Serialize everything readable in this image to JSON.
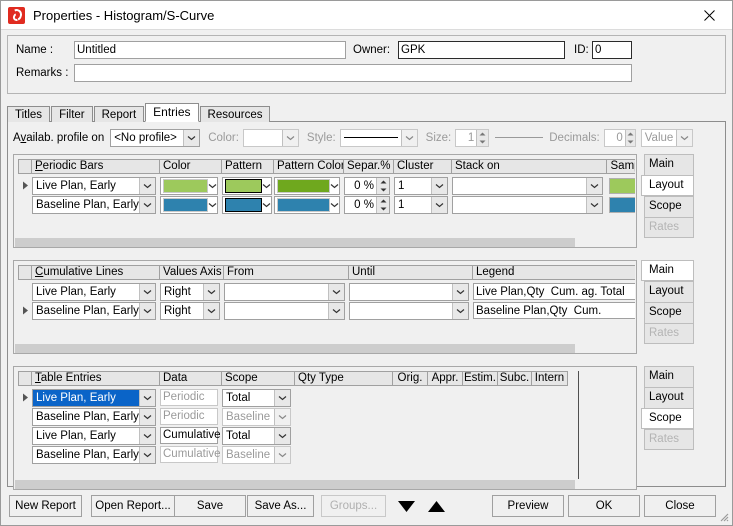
{
  "window": {
    "title": "Properties - Histogram/S-Curve",
    "app_icon": "spiral-app-icon",
    "close_label": "✕"
  },
  "header": {
    "name_label": "Name :",
    "name_value": "Untitled",
    "owner_label": "Owner:",
    "owner_value": "GPK",
    "id_label": "ID:",
    "id_value": "0",
    "remarks_label": "Remarks :",
    "remarks_value": "",
    "remarks_placeholder": ""
  },
  "tabs": [
    {
      "label": "Titles",
      "selected": false
    },
    {
      "label": "Filter",
      "selected": false
    },
    {
      "label": "Report",
      "selected": false
    },
    {
      "label": "Entries",
      "selected": true
    },
    {
      "label": "Resources",
      "selected": false
    }
  ],
  "toolbar": {
    "profile_label_pre": "A",
    "profile_label_accel": "v",
    "profile_label_post": "ailab. profile on",
    "profile_value": "<No profile>",
    "color_label": "Color:",
    "color_value": "",
    "style_label": "Style:",
    "style_value": "solid-line",
    "size_label": "Size:",
    "size_value": "1",
    "decimals_label": "Decimals:",
    "decimals_value": "0",
    "value_label": "Value"
  },
  "periodic_bars": {
    "headers": [
      "Periodic Bars",
      "Color",
      "Pattern",
      "Pattern Color",
      "Separ.%",
      "Cluster",
      "Stack on",
      "Sample"
    ],
    "header_accel_index": 0,
    "rows": [
      {
        "name": "Live Plan, Early",
        "color": "#9dc95c",
        "pattern": "#9dc95c",
        "pattern_color": "#6fa81e",
        "separ": "0 %",
        "cluster": "1",
        "stack_on": "",
        "sample": "#9dc95c",
        "marked": true
      },
      {
        "name": "Baseline Plan, Early",
        "color": "#2e82ae",
        "pattern": "#2e82ae",
        "pattern_color": "#2e82ae",
        "separ": "0 %",
        "cluster": "1",
        "stack_on": "",
        "sample": "#2e82ae",
        "marked": false
      }
    ],
    "side_tabs": [
      {
        "label": "Main",
        "selected": false,
        "disabled": false
      },
      {
        "label": "Layout",
        "selected": true,
        "disabled": false
      },
      {
        "label": "Scope",
        "selected": false,
        "disabled": false
      },
      {
        "label": "Rates",
        "selected": false,
        "disabled": true
      }
    ]
  },
  "cumulative_lines": {
    "headers": [
      "Cumulative Lines",
      "Values Axis",
      "From",
      "Until",
      "Legend"
    ],
    "rows": [
      {
        "name": "Live Plan, Early",
        "values_axis": "Right",
        "from": "",
        "until": "",
        "legend": "Live Plan,Qty  Cum. ag. Total",
        "marked": false
      },
      {
        "name": "Baseline Plan, Early",
        "values_axis": "Right",
        "from": "",
        "until": "",
        "legend": "Baseline Plan,Qty  Cum.",
        "marked": true
      }
    ],
    "side_tabs": [
      {
        "label": "Main",
        "selected": true,
        "disabled": false
      },
      {
        "label": "Layout",
        "selected": false,
        "disabled": false
      },
      {
        "label": "Scope",
        "selected": false,
        "disabled": false
      },
      {
        "label": "Rates",
        "selected": false,
        "disabled": true
      }
    ]
  },
  "table_entries": {
    "headers": [
      "Table Entries",
      "Data",
      "Scope",
      "Qty Type",
      "Orig.",
      "Appr.",
      "Estim.",
      "Subc.",
      "Intern"
    ],
    "rows": [
      {
        "name": "Live Plan, Early",
        "name_selected": true,
        "data": "Periodic",
        "data_disabled": true,
        "scope": "Total",
        "scope_disabled": false,
        "marked": true
      },
      {
        "name": "Baseline Plan, Early",
        "name_selected": false,
        "data": "Periodic",
        "data_disabled": true,
        "scope": "Baseline",
        "scope_disabled": true,
        "marked": false
      },
      {
        "name": "Live Plan, Early",
        "name_selected": false,
        "data": "Cumulative",
        "data_disabled": false,
        "scope": "Total",
        "scope_disabled": false,
        "marked": false
      },
      {
        "name": "Baseline Plan, Early",
        "name_selected": false,
        "data": "Cumulative",
        "data_disabled": true,
        "scope": "Baseline",
        "scope_disabled": true,
        "marked": false
      }
    ],
    "side_tabs": [
      {
        "label": "Main",
        "selected": false,
        "disabled": false
      },
      {
        "label": "Layout",
        "selected": false,
        "disabled": false
      },
      {
        "label": "Scope",
        "selected": true,
        "disabled": false
      },
      {
        "label": "Rates",
        "selected": false,
        "disabled": true
      }
    ]
  },
  "footer": {
    "new_report": "New Report",
    "open_report": "Open Report...",
    "save": "Save",
    "save_as": "Save As...",
    "groups": "Groups...",
    "move_down_icon": "triangle-down-icon",
    "move_up_icon": "triangle-up-icon",
    "preview": "Preview",
    "ok": "OK",
    "close": "Close"
  },
  "colors": {
    "accent_green": "#9dc95c",
    "accent_green_dark": "#6fa81e",
    "accent_blue": "#2e82ae",
    "selection_blue": "#0a64c8",
    "app_icon_red": "#e02b20"
  }
}
